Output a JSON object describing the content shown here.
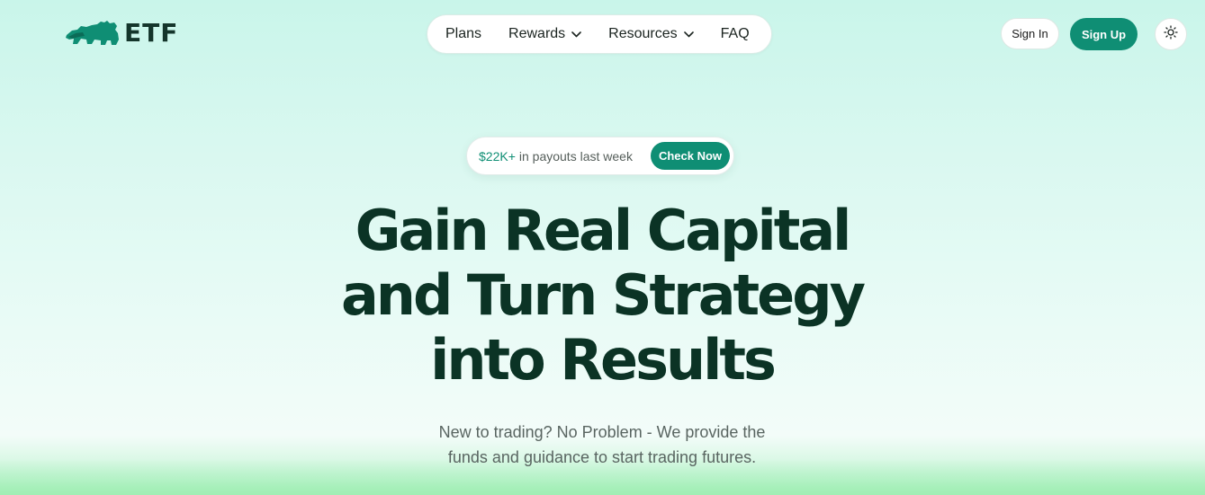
{
  "brand": {
    "logo_text": "ETF",
    "logo_icon": "bull-icon",
    "accent_color": "#0f8e74"
  },
  "nav": {
    "items": [
      {
        "label": "Plans",
        "has_dropdown": false
      },
      {
        "label": "Rewards",
        "has_dropdown": true
      },
      {
        "label": "Resources",
        "has_dropdown": true
      },
      {
        "label": "FAQ",
        "has_dropdown": false
      }
    ]
  },
  "header": {
    "signin_label": "Sign In",
    "signup_label": "Sign Up",
    "theme_icon": "sun-icon"
  },
  "promo": {
    "amount": "$22K+",
    "text": "in payouts last week",
    "button_label": "Check Now"
  },
  "hero": {
    "title_lines": [
      "Gain Real Capital",
      "and Turn Strategy",
      "into Results"
    ],
    "subtitle_lines": [
      "New to trading? No Problem - We provide the",
      "funds and guidance to start trading futures."
    ]
  }
}
